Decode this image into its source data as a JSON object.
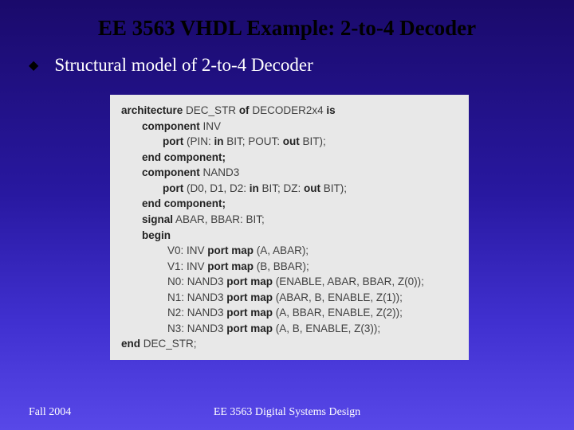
{
  "title": "EE 3563 VHDL Example: 2-to-4 Decoder",
  "bullet": "Structural model of 2-to-4 Decoder",
  "code": {
    "line1_pre": "architecture",
    "line1_mid": " DEC_STR ",
    "line1_of": "of",
    "line1_post": " DECODER2x4 ",
    "line1_is": "is",
    "line2_pre": "component",
    "line2_post": " INV",
    "line3_pre": "port",
    "line3_mid1": " (PIN: ",
    "line3_in": "in",
    "line3_mid2": " BIT; POUT: ",
    "line3_out": "out",
    "line3_post": " BIT);",
    "line4": "end component;",
    "line5_pre": "component",
    "line5_post": " NAND3",
    "line6_pre": "port",
    "line6_mid1": " (D0, D1, D2: ",
    "line6_in": "in",
    "line6_mid2": " BIT; DZ: ",
    "line6_out": "out",
    "line6_post": " BIT);",
    "line7": "end component;",
    "line8_pre": "signal",
    "line8_post": " ABAR, BBAR: BIT;",
    "line9": "begin",
    "line10_pre": "V0: INV ",
    "line10_kw": "port map",
    "line10_post": " (A, ABAR);",
    "line11_pre": "V1: INV ",
    "line11_kw": "port map",
    "line11_post": " (B, BBAR);",
    "line12_pre": "N0: NAND3 ",
    "line12_kw": "port map",
    "line12_post": " (ENABLE, ABAR, BBAR, Z(0));",
    "line13_pre": "N1: NAND3 ",
    "line13_kw": "port map",
    "line13_post": " (ABAR, B, ENABLE, Z(1));",
    "line14_pre": "N2: NAND3 ",
    "line14_kw": "port map",
    "line14_post": " (A, BBAR, ENABLE, Z(2));",
    "line15_pre": "N3: NAND3 ",
    "line15_kw": "port map",
    "line15_post": " (A, B, ENABLE, Z(3));",
    "line16_pre": "end",
    "line16_post": " DEC_STR;"
  },
  "footer": {
    "left": "Fall 2004",
    "center": "EE 3563 Digital Systems Design"
  }
}
